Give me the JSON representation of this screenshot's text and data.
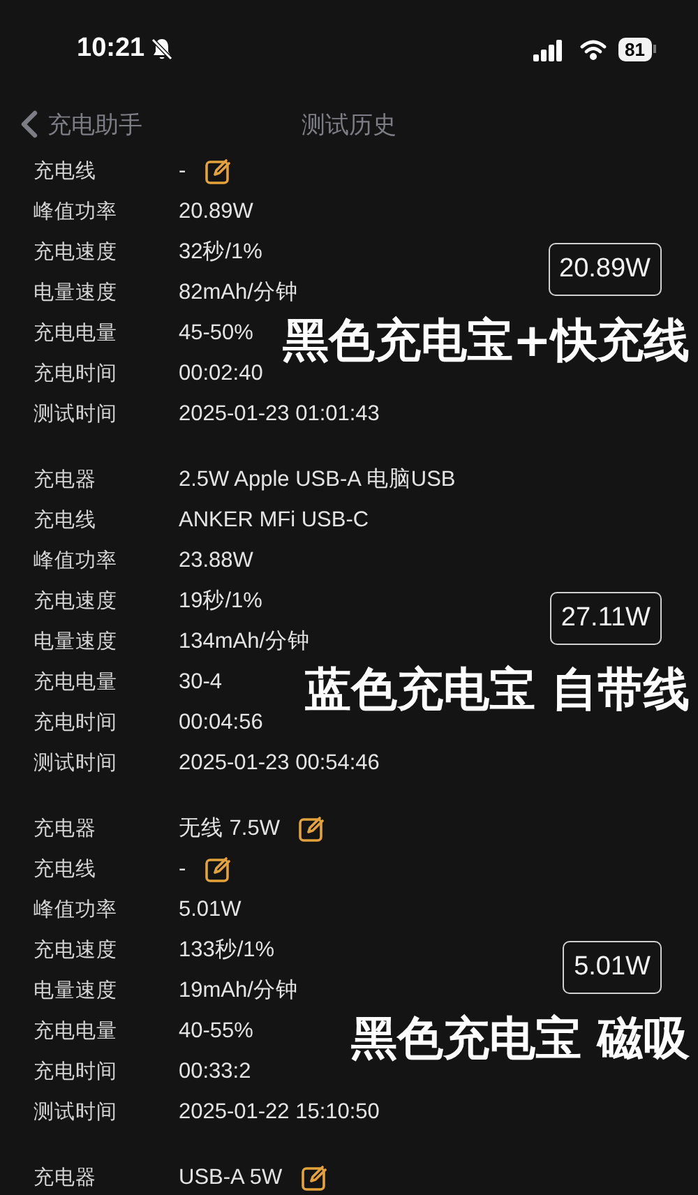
{
  "status_bar": {
    "time": "10:21",
    "battery": "81"
  },
  "nav": {
    "back": "充电助手",
    "title": "测试历史"
  },
  "records": [
    {
      "fields": [
        {
          "label": "充电线",
          "value": "-",
          "editable": true
        },
        {
          "label": "峰值功率",
          "value": "20.89W",
          "editable": false
        },
        {
          "label": "充电速度",
          "value": "32秒/1%",
          "editable": false
        },
        {
          "label": "电量速度",
          "value": "82mAh/分钟",
          "editable": false
        },
        {
          "label": "充电电量",
          "value": "45-50%",
          "editable": false
        },
        {
          "label": "充电时间",
          "value": "00:02:40",
          "editable": false
        },
        {
          "label": "测试时间",
          "value": "2025-01-23 01:01:43",
          "editable": false
        }
      ],
      "badge": "20.89W",
      "caption": "黑色充电宝+快充线"
    },
    {
      "fields": [
        {
          "label": "充电器",
          "value": "2.5W Apple USB-A 电脑USB",
          "editable": false
        },
        {
          "label": "充电线",
          "value": "ANKER MFi USB-C",
          "editable": false
        },
        {
          "label": "峰值功率",
          "value": "23.88W",
          "editable": false
        },
        {
          "label": "充电速度",
          "value": "19秒/1%",
          "editable": false
        },
        {
          "label": "电量速度",
          "value": "134mAh/分钟",
          "editable": false
        },
        {
          "label": "充电电量",
          "value": "30-4",
          "editable": false
        },
        {
          "label": "充电时间",
          "value": "00:04:56",
          "editable": false
        },
        {
          "label": "测试时间",
          "value": "2025-01-23 00:54:46",
          "editable": false
        }
      ],
      "badge": "27.11W",
      "caption": "蓝色充电宝 自带线"
    },
    {
      "fields": [
        {
          "label": "充电器",
          "value": "无线 7.5W",
          "editable": true
        },
        {
          "label": "充电线",
          "value": "-",
          "editable": true
        },
        {
          "label": "峰值功率",
          "value": "5.01W",
          "editable": false
        },
        {
          "label": "充电速度",
          "value": "133秒/1%",
          "editable": false
        },
        {
          "label": "电量速度",
          "value": "19mAh/分钟",
          "editable": false
        },
        {
          "label": "充电电量",
          "value": "40-55%",
          "editable": false
        },
        {
          "label": "充电时间",
          "value": "00:33:2",
          "editable": false
        },
        {
          "label": "测试时间",
          "value": "2025-01-22 15:10:50",
          "editable": false
        }
      ],
      "badge": "5.01W",
      "caption": "黑色充电宝 磁吸"
    },
    {
      "fields": [
        {
          "label": "充电器",
          "value": "USB-A 5W",
          "editable": true
        }
      ]
    }
  ]
}
